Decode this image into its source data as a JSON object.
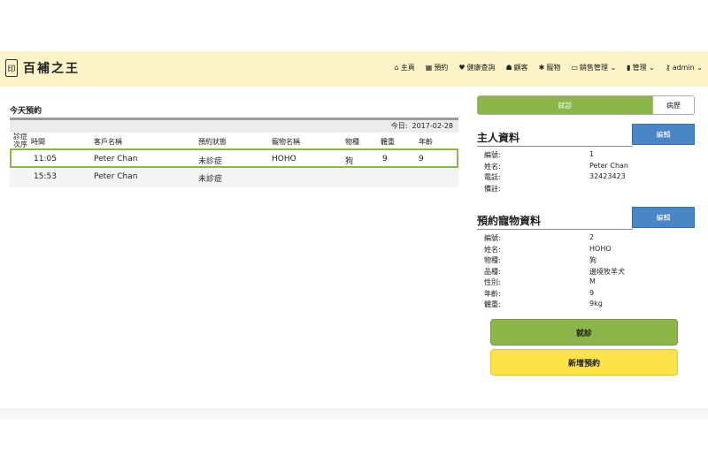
{
  "brand": {
    "logo_icon": "seal-icon",
    "title": "百補之王"
  },
  "nav": {
    "items": [
      {
        "icon": "home-icon",
        "glyph": "⌂",
        "label": "主頁"
      },
      {
        "icon": "calendar-icon",
        "glyph": "▦",
        "label": "預約"
      },
      {
        "icon": "heart-icon",
        "glyph": "♥",
        "label": "健康查詢"
      },
      {
        "icon": "users-icon",
        "glyph": "☗",
        "label": "顧客"
      },
      {
        "icon": "paw-icon",
        "glyph": "✱",
        "label": "寵物"
      },
      {
        "icon": "card-icon",
        "glyph": "▭",
        "label": "銷售管理 ⌄"
      },
      {
        "icon": "file-icon",
        "glyph": "▮",
        "label": "管理 ⌄"
      },
      {
        "icon": "key-icon",
        "glyph": "⚷",
        "label": "admin ⌄"
      }
    ]
  },
  "today": {
    "heading": "今天預約",
    "date_label": "今日:",
    "date": "2017-02-28",
    "columns": [
      "診症\n次序",
      "時間",
      "客戶名稱",
      "預約狀態",
      "寵物名稱",
      "物種",
      "體重",
      "年齡"
    ],
    "rows": [
      {
        "time": "11:05",
        "client": "Peter Chan",
        "status": "未診症",
        "pet": "HOHO",
        "species": "狗",
        "weight": "9",
        "age": "9"
      },
      {
        "time": "15:53",
        "client": "Peter Chan",
        "status": "未診症",
        "pet": "",
        "species": "",
        "weight": "",
        "age": ""
      }
    ]
  },
  "tabs": {
    "active": "就診",
    "inactive": "病歷"
  },
  "owner": {
    "title": "主人資料",
    "edit_label": "編輯",
    "fields": [
      {
        "k": "編號:",
        "v": "1"
      },
      {
        "k": "姓名:",
        "v": "Peter Chan"
      },
      {
        "k": "電話:",
        "v": "32423423"
      },
      {
        "k": "備註:",
        "v": ""
      }
    ]
  },
  "pet": {
    "title": "預約寵物資料",
    "edit_label": "編輯",
    "fields": [
      {
        "k": "編號:",
        "v": "2"
      },
      {
        "k": "姓名:",
        "v": "HOHO"
      },
      {
        "k": "物種:",
        "v": "狗"
      },
      {
        "k": "品種:",
        "v": "邊境牧羊犬"
      },
      {
        "k": "性別:",
        "v": "M"
      },
      {
        "k": "年齡:",
        "v": "9"
      },
      {
        "k": "體重:",
        "v": "9kg"
      }
    ]
  },
  "actions": {
    "consult": "就診",
    "new_appointment": "新增預約"
  },
  "colors": {
    "nav_bg": "#fdf3c8",
    "green": "#8cb54a",
    "blue": "#4a86c5",
    "yellow": "#fde24a"
  }
}
